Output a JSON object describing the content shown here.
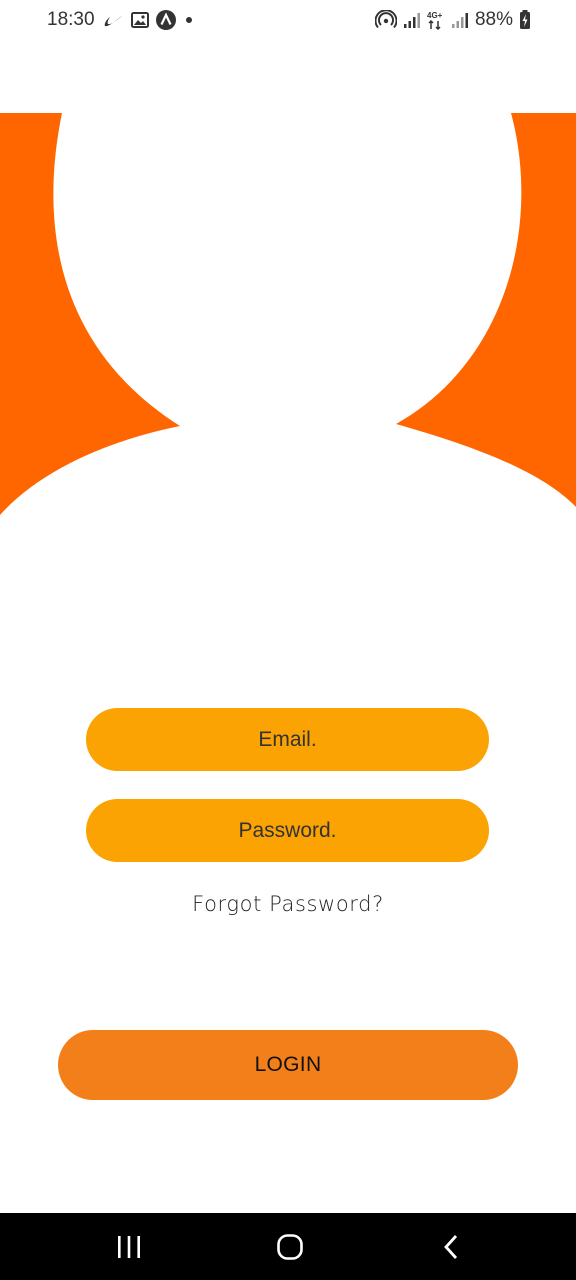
{
  "status_bar": {
    "time": "18:30",
    "battery_percent": "88%",
    "network_type": "4G+",
    "left_icons": [
      "nike-swoosh-icon",
      "gallery-icon",
      "app-a-icon",
      "dot-icon"
    ],
    "right_icons": [
      "hotspot-icon",
      "signal-icon",
      "network-4g-icon",
      "signal-icon-2",
      "battery-charging-icon"
    ]
  },
  "login": {
    "email_placeholder": "Email.",
    "password_placeholder": "Password.",
    "forgot_password": "Forgot Password?",
    "login_button": "LOGIN"
  },
  "colors": {
    "hero_orange": "#ff6600",
    "field_yellow": "#fba303",
    "button_orange": "#f27f1a",
    "nav_bar": "#000000"
  },
  "nav_bar": {
    "buttons": [
      "recents-icon",
      "home-icon",
      "back-icon"
    ]
  }
}
